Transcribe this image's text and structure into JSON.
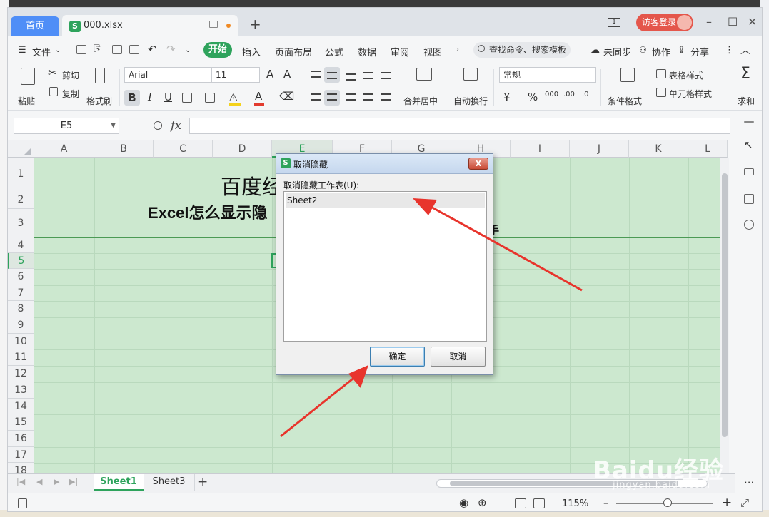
{
  "tabs": {
    "home": "首页",
    "file": "000.xlsx"
  },
  "title_bar": {
    "window_count": "1",
    "login": "访客登录"
  },
  "menu": {
    "file": "文件",
    "items": [
      "开始",
      "插入",
      "页面布局",
      "公式",
      "数据",
      "审阅",
      "视图"
    ],
    "search": "查找命令、搜索模板",
    "unsync": "未同步",
    "collab": "协作",
    "share": "分享"
  },
  "ribbon": {
    "paste": "粘贴",
    "cut": "剪切",
    "copy": "复制",
    "format_painter": "格式刷",
    "font_name": "Arial",
    "font_size": "11",
    "merge_center": "合并居中",
    "wrap": "自动换行",
    "number_format": "常规",
    "conditional": "条件格式",
    "table_style": "表格样式",
    "cell_style": "单元格样式",
    "sum": "求和"
  },
  "formula_bar": {
    "cell_ref": "E5",
    "fx": "fx"
  },
  "grid": {
    "columns": [
      "A",
      "B",
      "C",
      "D",
      "E",
      "F",
      "G",
      "H",
      "I",
      "J",
      "K",
      "L"
    ],
    "selected_column": "E",
    "rows": [
      "1",
      "2",
      "3",
      "4",
      "5",
      "6",
      "7",
      "8",
      "9",
      "10",
      "11",
      "12",
      "13",
      "14",
      "15",
      "16",
      "17",
      "18"
    ],
    "selected_row": "5",
    "title_text": "百度经",
    "subtitle_text": "Excel怎么显示隐",
    "row3_tail": "手",
    "background_color": "#cce8cf",
    "accent_color": "#2ea35c"
  },
  "sheets": {
    "active": "Sheet1",
    "other": "Sheet3"
  },
  "status": {
    "zoom": "115%"
  },
  "dialog": {
    "title": "取消隐藏",
    "label": "取消隐藏工作表(U):",
    "items": [
      "Sheet2"
    ],
    "ok": "确定",
    "cancel": "取消",
    "close": "X"
  },
  "watermark": {
    "main": "Baidu经验",
    "sub": "jingyan.baidu.com"
  },
  "annotation_color": "#e8342c"
}
